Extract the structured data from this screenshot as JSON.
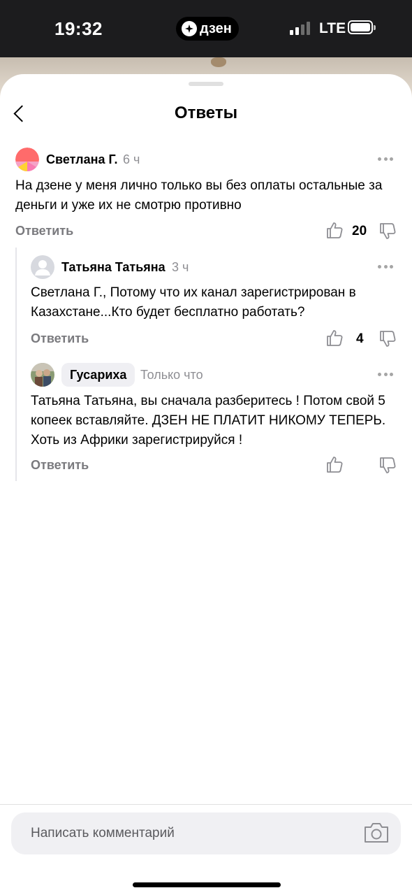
{
  "status_bar": {
    "time": "19:32",
    "app_badge": "дзен",
    "network": "LTE"
  },
  "sheet": {
    "title": "Ответы"
  },
  "comments": [
    {
      "author": "Светлана Г.",
      "time": "6 ч",
      "text": "На дзене у меня лично только вы без оплаты остальные за деньги и уже их не смотрю противно",
      "reply_label": "Ответить",
      "likes": "20"
    },
    {
      "author": "Татьяна Татьяна",
      "time": "3 ч",
      "text": "Светлана Г., Потому что их канал зарегистрирован в Казахстане...Кто будет бесплатно работать?",
      "reply_label": "Ответить",
      "likes": "4"
    },
    {
      "author": "Гусариха",
      "time": "Только что",
      "text": "Татьяна Татьяна, вы сначала разберитесь ! Потом свой 5 копеек вставляйте. ДЗЕН НЕ ПЛАТИТ НИКОМУ ТЕПЕРЬ. Хоть из Африки зарегистрируйся !",
      "reply_label": "Ответить",
      "likes": ""
    }
  ],
  "composer": {
    "placeholder": "Написать комментарий"
  },
  "icons": {
    "back": "chevron-left-icon",
    "more": "more-dots-icon",
    "like": "thumbs-up-icon",
    "dislike": "thumbs-down-icon",
    "camera": "camera-icon"
  },
  "colors": {
    "muted": "#8e8e93",
    "accent_avatar": "#ff6b6b"
  }
}
